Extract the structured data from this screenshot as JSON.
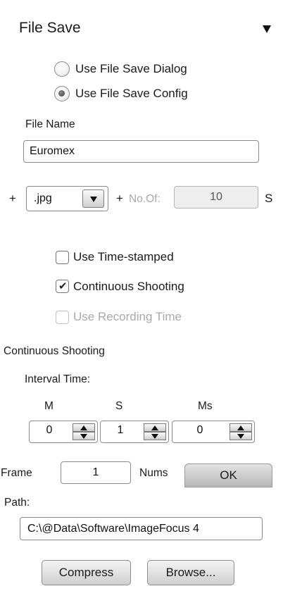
{
  "panel": {
    "title": "File Save",
    "collapse_icon": "triangle-down-icon"
  },
  "save_mode": {
    "option_dialog": "Use File Save Dialog",
    "option_config": "Use File Save Config",
    "selected": "Use File Save Config"
  },
  "file_name": {
    "label": "File Name",
    "value": "Euromex"
  },
  "format_row": {
    "plus1": "+",
    "format_value": ".jpg",
    "plus2": "+",
    "no_of_label": "No.Of:",
    "no_of_value": "10",
    "suffix": "S"
  },
  "options": {
    "time_stamped": {
      "label": "Use Time-stamped",
      "checked": false,
      "enabled": true
    },
    "continuous": {
      "label": "Continuous Shooting",
      "checked": true,
      "enabled": true
    },
    "recording_time": {
      "label": "Use Recording Time",
      "checked": false,
      "enabled": false
    }
  },
  "continuous": {
    "section_label": "Continuous Shooting",
    "interval_label": "Interval Time:",
    "minutes": {
      "label": "M",
      "value": "0"
    },
    "seconds": {
      "label": "S",
      "value": "1"
    },
    "millis": {
      "label": "Ms",
      "value": "0"
    }
  },
  "frame": {
    "label": "Frame",
    "value": "1",
    "nums_label": "Nums",
    "ok_label": "OK"
  },
  "path": {
    "label": "Path:",
    "value": "C:\\@Data\\Software\\ImageFocus 4"
  },
  "buttons": {
    "compress": "Compress",
    "browse": "Browse..."
  }
}
